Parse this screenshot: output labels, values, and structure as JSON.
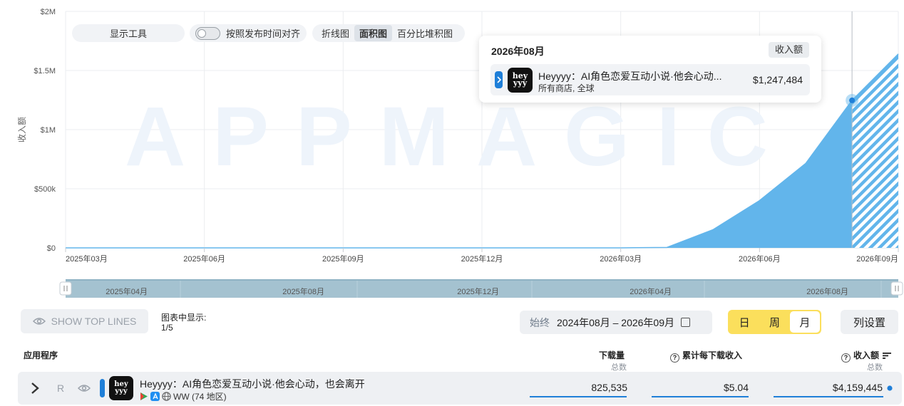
{
  "chart_data": {
    "type": "area",
    "ylabel": "收入额",
    "watermark": "APPMAGIC",
    "ylim": [
      0,
      2000000
    ],
    "yticks": [
      {
        "value": 0,
        "label": "$0"
      },
      {
        "value": 500000,
        "label": "$500k"
      },
      {
        "value": 1000000,
        "label": "$1M"
      },
      {
        "value": 1500000,
        "label": "$1.5M"
      },
      {
        "value": 2000000,
        "label": "$2M"
      }
    ],
    "x": [
      "2025-03",
      "2025-04",
      "2025-05",
      "2025-06",
      "2025-07",
      "2025-08",
      "2025-09",
      "2025-10",
      "2025-11",
      "2025-12",
      "2026-01",
      "2026-02",
      "2026-03",
      "2026-04",
      "2026-05",
      "2026-06",
      "2026-07",
      "2026-08",
      "2026-09"
    ],
    "xtick_labels": [
      {
        "x": "2025-03",
        "label": "2025年03月"
      },
      {
        "x": "2025-06",
        "label": "2025年06月"
      },
      {
        "x": "2025-09",
        "label": "2025年09月"
      },
      {
        "x": "2025-12",
        "label": "2025年12月"
      },
      {
        "x": "2026-03",
        "label": "2026年03月"
      },
      {
        "x": "2026-06",
        "label": "2026年06月"
      },
      {
        "x": "2026-09",
        "label": "2026年09月"
      }
    ],
    "series": [
      {
        "name": "Heyyyy：AI角色恋爱互动小说·他会心动，也会离开",
        "color": "#62b5eb",
        "values": [
          0,
          0,
          0,
          0,
          0,
          0,
          0,
          0,
          0,
          0,
          0,
          0,
          0,
          4000,
          155000,
          400000,
          715000,
          1247484,
          1640000
        ],
        "incomplete_from": "2026-08"
      }
    ],
    "highlight": {
      "x": "2026-08"
    },
    "grid": true
  },
  "navigator": {
    "labels": [
      "2025年04月",
      "2025年08月",
      "2025年12月",
      "2026年04月",
      "2026年08月"
    ]
  },
  "controls": {
    "tools_label": "显示工具",
    "align_label": "按照发布时间对齐",
    "chart_types": [
      "折线图",
      "面积图",
      "百分比堆积图"
    ],
    "active_chart_type": "面积图"
  },
  "tooltip": {
    "date": "2026年08月",
    "metric": "收入额",
    "app_name": "Heyyyy：AI角色恋爱互动小说·他会心动...",
    "app_sub": "所有商店, 全球",
    "value": "$1,247,484"
  },
  "app_icon": {
    "line1": "hey",
    "line2": "yyy"
  },
  "toolbar": {
    "show_top_lines": "SHOW TOP LINES",
    "shown_label": "图表中显示:",
    "shown_count": "1/5",
    "date_prefix": "始终",
    "date_range": "2024年08月 – 2026年09月",
    "periods": [
      "日",
      "周",
      "月"
    ],
    "active_period": "月",
    "column_settings": "列设置"
  },
  "table": {
    "col_app": "应用程序",
    "col_downloads": "下载量",
    "col_downloads_sub": "总数",
    "col_rpd": "累计每下载收入",
    "col_revenue": "收入额",
    "col_revenue_sub": "总数",
    "rows": [
      {
        "r_label": "R",
        "name": "Heyyyy：AI角色恋爱互动小说·他会心动，也会离开",
        "region": "WW (74 地区)",
        "downloads": "825,535",
        "rpd": "$5.04",
        "revenue": "$4,159,445"
      }
    ]
  }
}
